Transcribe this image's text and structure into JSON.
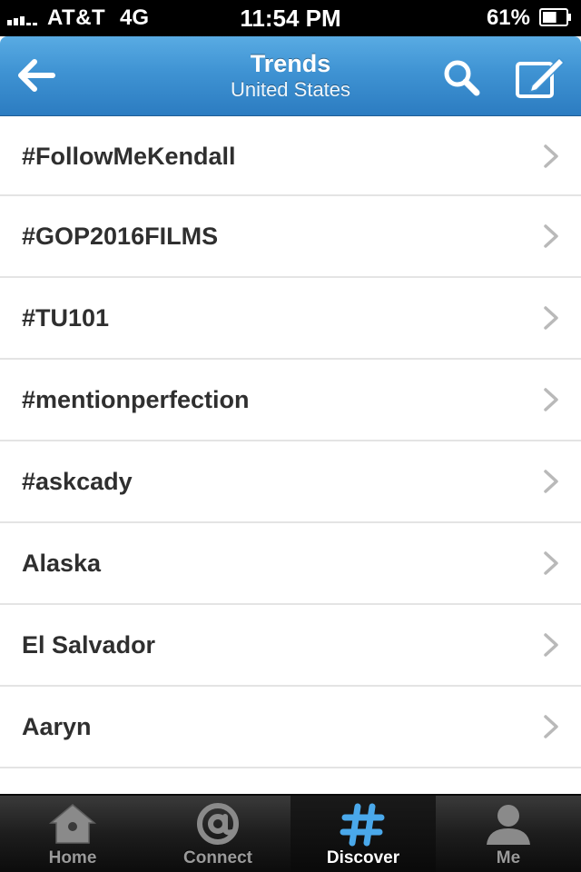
{
  "status_bar": {
    "carrier": "AT&T",
    "network": "4G",
    "time": "11:54 PM",
    "battery": "61%",
    "battery_level": 0.61
  },
  "nav": {
    "title": "Trends",
    "subtitle": "United States",
    "icons": {
      "back": "back-arrow-icon",
      "search": "search-icon",
      "compose": "compose-icon"
    }
  },
  "trends": [
    {
      "label": "#FollowMeKendall"
    },
    {
      "label": "#GOP2016FILMS"
    },
    {
      "label": "#TU101"
    },
    {
      "label": "#mentionperfection"
    },
    {
      "label": "#askcady"
    },
    {
      "label": "Alaska"
    },
    {
      "label": "El Salvador"
    },
    {
      "label": "Aaryn"
    },
    {
      "label": ""
    }
  ],
  "tabs": [
    {
      "label": "Home",
      "icon": "home-icon",
      "active": false
    },
    {
      "label": "Connect",
      "icon": "at-sign-icon",
      "active": false
    },
    {
      "label": "Discover",
      "icon": "hashtag-icon",
      "active": true
    },
    {
      "label": "Me",
      "icon": "person-icon",
      "active": false
    }
  ],
  "colors": {
    "nav_blue": "#3f93d3",
    "active_tab_icon": "#4aa8ea",
    "text_dark": "#2f2f2f"
  }
}
